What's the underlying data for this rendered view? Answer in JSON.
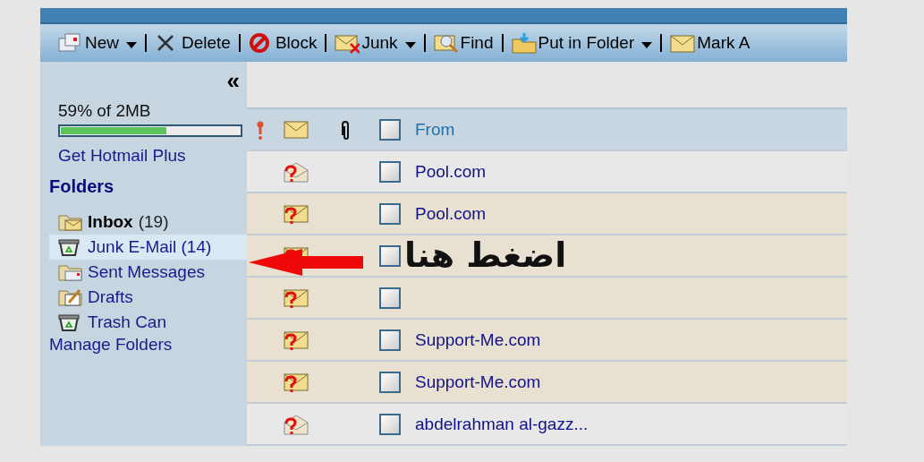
{
  "toolbar": [
    {
      "label": "New",
      "kind": "new",
      "dropdown": true
    },
    {
      "label": "Delete",
      "kind": "delete",
      "dropdown": false
    },
    {
      "label": "Block",
      "kind": "block",
      "dropdown": false
    },
    {
      "label": "Junk",
      "kind": "junk",
      "dropdown": true
    },
    {
      "label": "Find",
      "kind": "find",
      "dropdown": false
    },
    {
      "label": "Put in Folder",
      "kind": "folder",
      "dropdown": true
    },
    {
      "label": "Mark A",
      "kind": "mail",
      "dropdown": false
    }
  ],
  "sidebar": {
    "collapse": "«",
    "quota": {
      "text": "59% of 2MB",
      "level": 0.59
    },
    "upgrade_link": "Get Hotmail Plus",
    "folders_heading": "Folders",
    "folders": [
      {
        "name": "Inbox",
        "count": "(19)",
        "kind": "inbox",
        "bold": true,
        "selected": false
      },
      {
        "name": "Junk E-Mail (14)",
        "kind": "bin",
        "bold": false,
        "selected": true
      },
      {
        "name": "Sent Messages",
        "kind": "sent",
        "bold": false,
        "selected": false
      },
      {
        "name": "Drafts",
        "kind": "drafts",
        "bold": false,
        "selected": false
      },
      {
        "name": "Trash Can",
        "kind": "bin",
        "bold": false,
        "selected": false
      }
    ],
    "manage_link": "Manage Folders"
  },
  "table": {
    "columns": [
      {
        "kind": "priority"
      },
      {
        "kind": "envelope"
      },
      {
        "kind": "attachment"
      },
      {
        "kind": "checkbox",
        "checked": false
      },
      {
        "kind": "text",
        "label": "From"
      }
    ],
    "rows": [
      {
        "read": true,
        "checked": false,
        "from": "Pool.com"
      },
      {
        "read": false,
        "checked": false,
        "from": "Pool.com"
      },
      {
        "read": false,
        "checked": false,
        "annotation": "اضغط هنا"
      },
      {
        "read": false,
        "checked": false
      },
      {
        "read": false,
        "checked": false,
        "from": "Support-Me.com"
      },
      {
        "read": false,
        "checked": false,
        "from": "Support-Me.com"
      },
      {
        "read": true,
        "checked": false,
        "from": "abdelrahman al-gazz..."
      }
    ]
  }
}
